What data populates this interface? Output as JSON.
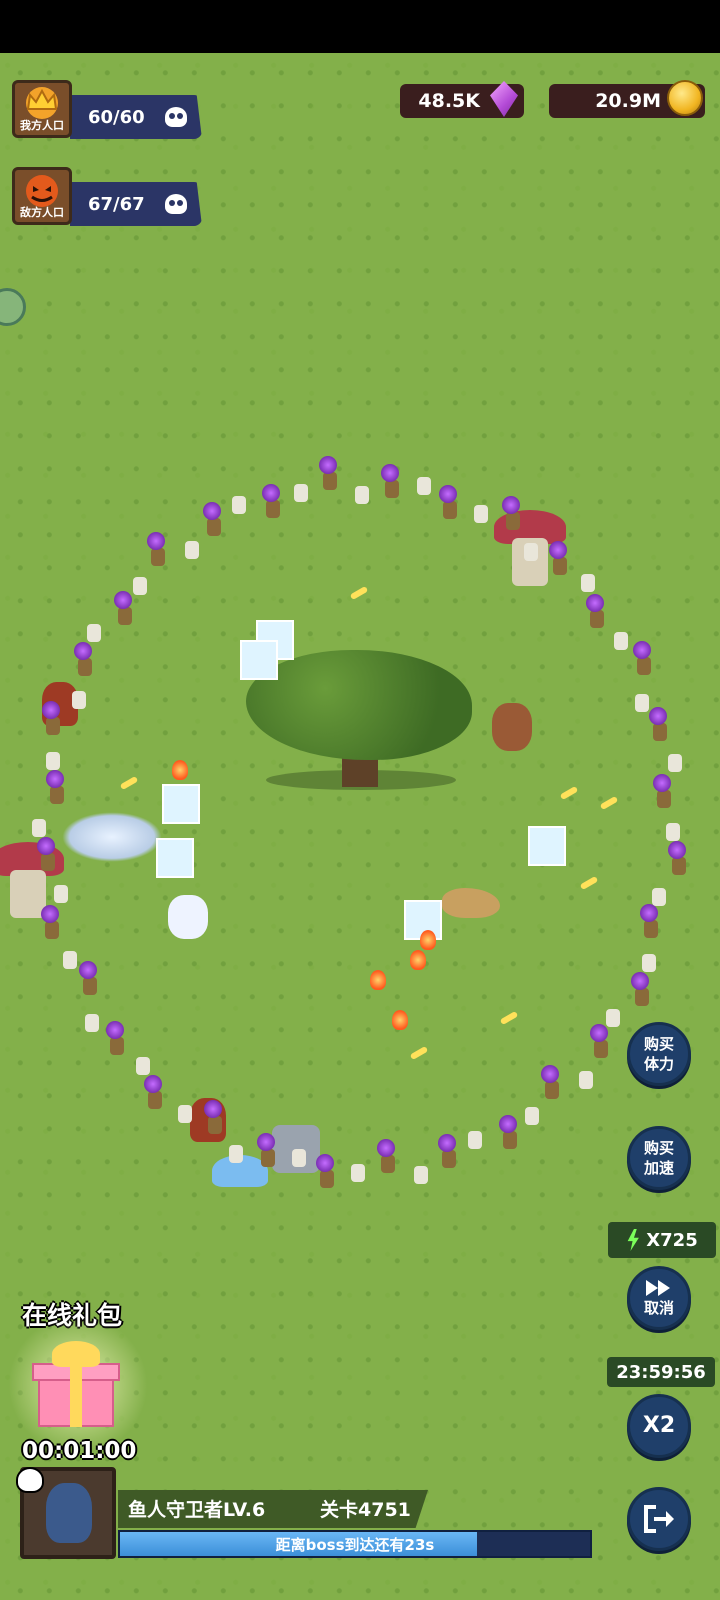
{
  "resources": {
    "gems": "48.5K",
    "coins": "20.9M"
  },
  "population": {
    "ally": {
      "label": "我方人口",
      "value": "60/60"
    },
    "enemy": {
      "label": "敌方人口",
      "value": "67/67"
    }
  },
  "buttons": {
    "buy_stamina": [
      "购买",
      "体力"
    ],
    "buy_speed": [
      "购买",
      "加速"
    ],
    "cancel": "取消",
    "x2": "X2"
  },
  "energy": {
    "value": "X725"
  },
  "countdown": "23:59:56",
  "online_gift": {
    "title": "在线礼包",
    "timer": "00:01:00"
  },
  "boss": {
    "name": "鱼人守卫者LV.6",
    "stage": "关卡4751",
    "progress_text": "距离boss到达还有23s",
    "progress": 0.76
  },
  "colors": {
    "grass": "#83b04a",
    "button": "#1f3f6a",
    "bar": "#2b3566",
    "progress": "#3c8fd8"
  },
  "icons": [
    "crown-icon",
    "pumpkin-icon",
    "skull-icon",
    "gem-icon",
    "coin-icon",
    "lightning-icon",
    "fast-forward-icon",
    "exit-icon",
    "gift-icon"
  ]
}
